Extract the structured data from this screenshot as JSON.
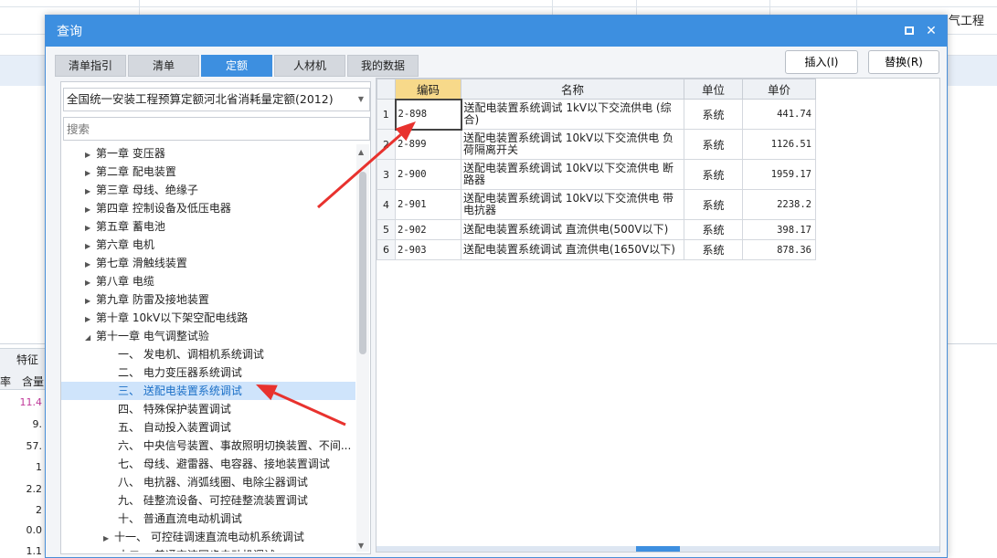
{
  "background": {
    "corner_text": "气工程",
    "bottom_tab": "特征及",
    "column_header_a": "率",
    "column_header_b": "含量",
    "column_values": [
      "11.4",
      "9.",
      "57.",
      "1",
      "2.2",
      "2",
      "0.0",
      "1.1"
    ]
  },
  "dialog": {
    "title": "查询",
    "tabs": [
      {
        "label": "清单指引",
        "active": false
      },
      {
        "label": "清单",
        "active": false
      },
      {
        "label": "定额",
        "active": true
      },
      {
        "label": "人材机",
        "active": false
      },
      {
        "label": "我的数据",
        "active": false
      }
    ],
    "buttons": {
      "insert": "插入(I)",
      "replace": "替换(R)"
    },
    "quota_select": "全国统一安装工程预算定额河北省消耗量定额(2012)",
    "search_placeholder": "搜索",
    "tree": [
      {
        "label": "第一章 变压器",
        "level": 0,
        "arrow": "right",
        "selected": false
      },
      {
        "label": "第二章 配电装置",
        "level": 0,
        "arrow": "right",
        "selected": false
      },
      {
        "label": "第三章 母线、绝缘子",
        "level": 0,
        "arrow": "right",
        "selected": false
      },
      {
        "label": "第四章 控制设备及低压电器",
        "level": 0,
        "arrow": "right",
        "selected": false
      },
      {
        "label": "第五章 蓄电池",
        "level": 0,
        "arrow": "right",
        "selected": false
      },
      {
        "label": "第六章 电机",
        "level": 0,
        "arrow": "right",
        "selected": false
      },
      {
        "label": "第七章 滑触线装置",
        "level": 0,
        "arrow": "right",
        "selected": false
      },
      {
        "label": "第八章 电缆",
        "level": 0,
        "arrow": "right",
        "selected": false
      },
      {
        "label": "第九章 防雷及接地装置",
        "level": 0,
        "arrow": "right",
        "selected": false
      },
      {
        "label": "第十章 10kV以下架空配电线路",
        "level": 0,
        "arrow": "right",
        "selected": false
      },
      {
        "label": "第十一章 电气调整试验",
        "level": 0,
        "arrow": "down",
        "selected": false
      },
      {
        "label": "一、 发电机、调相机系统调试",
        "level": 1,
        "arrow": "",
        "selected": false
      },
      {
        "label": "二、 电力变压器系统调试",
        "level": 1,
        "arrow": "",
        "selected": false
      },
      {
        "label": "三、 送配电装置系统调试",
        "level": 1,
        "arrow": "",
        "selected": true
      },
      {
        "label": "四、 特殊保护装置调试",
        "level": 1,
        "arrow": "",
        "selected": false
      },
      {
        "label": "五、 自动投入装置调试",
        "level": 1,
        "arrow": "",
        "selected": false
      },
      {
        "label": "六、 中央信号装置、事故照明切换装置、不间...",
        "level": 1,
        "arrow": "",
        "selected": false
      },
      {
        "label": "七、 母线、避雷器、电容器、接地装置调试",
        "level": 1,
        "arrow": "",
        "selected": false
      },
      {
        "label": "八、 电抗器、消弧线圈、电除尘器调试",
        "level": 1,
        "arrow": "",
        "selected": false
      },
      {
        "label": "九、 硅整流设备、可控硅整流装置调试",
        "level": 1,
        "arrow": "",
        "selected": false
      },
      {
        "label": "十、 普通直流电动机调试",
        "level": 1,
        "arrow": "",
        "selected": false
      },
      {
        "label": "十一、 可控硅调速直流电动机系统调试",
        "level": 1,
        "arrow": "right",
        "selected": false
      },
      {
        "label": "十二、 普通交流同步电动机调试",
        "level": 1,
        "arrow": "",
        "selected": false
      }
    ],
    "grid": {
      "headers": {
        "code": "编码",
        "name": "名称",
        "unit": "单位",
        "price": "单价"
      },
      "rows": [
        {
          "no": "1",
          "code": "2-898",
          "name": "送配电装置系统调试 1kV以下交流供电 (综合)",
          "unit": "系统",
          "price": "441.74",
          "active": true
        },
        {
          "no": "2",
          "code": "2-899",
          "name": "送配电装置系统调试 10kV以下交流供电 负荷隔离开关",
          "unit": "系统",
          "price": "1126.51",
          "active": false
        },
        {
          "no": "3",
          "code": "2-900",
          "name": "送配电装置系统调试 10kV以下交流供电 断路器",
          "unit": "系统",
          "price": "1959.17",
          "active": false
        },
        {
          "no": "4",
          "code": "2-901",
          "name": "送配电装置系统调试 10kV以下交流供电 带电抗器",
          "unit": "系统",
          "price": "2238.2",
          "active": false
        },
        {
          "no": "5",
          "code": "2-902",
          "name": "送配电装置系统调试 直流供电(500V以下)",
          "unit": "系统",
          "price": "398.17",
          "active": false
        },
        {
          "no": "6",
          "code": "2-903",
          "name": "送配电装置系统调试 直流供电(1650V以下)",
          "unit": "系统",
          "price": "878.36",
          "active": false
        }
      ]
    }
  },
  "colors": {
    "accent": "#3d8fe0",
    "annotation_arrow": "#e8322e",
    "code_header": "#f7d98a",
    "selection": "#cfe4fb"
  }
}
